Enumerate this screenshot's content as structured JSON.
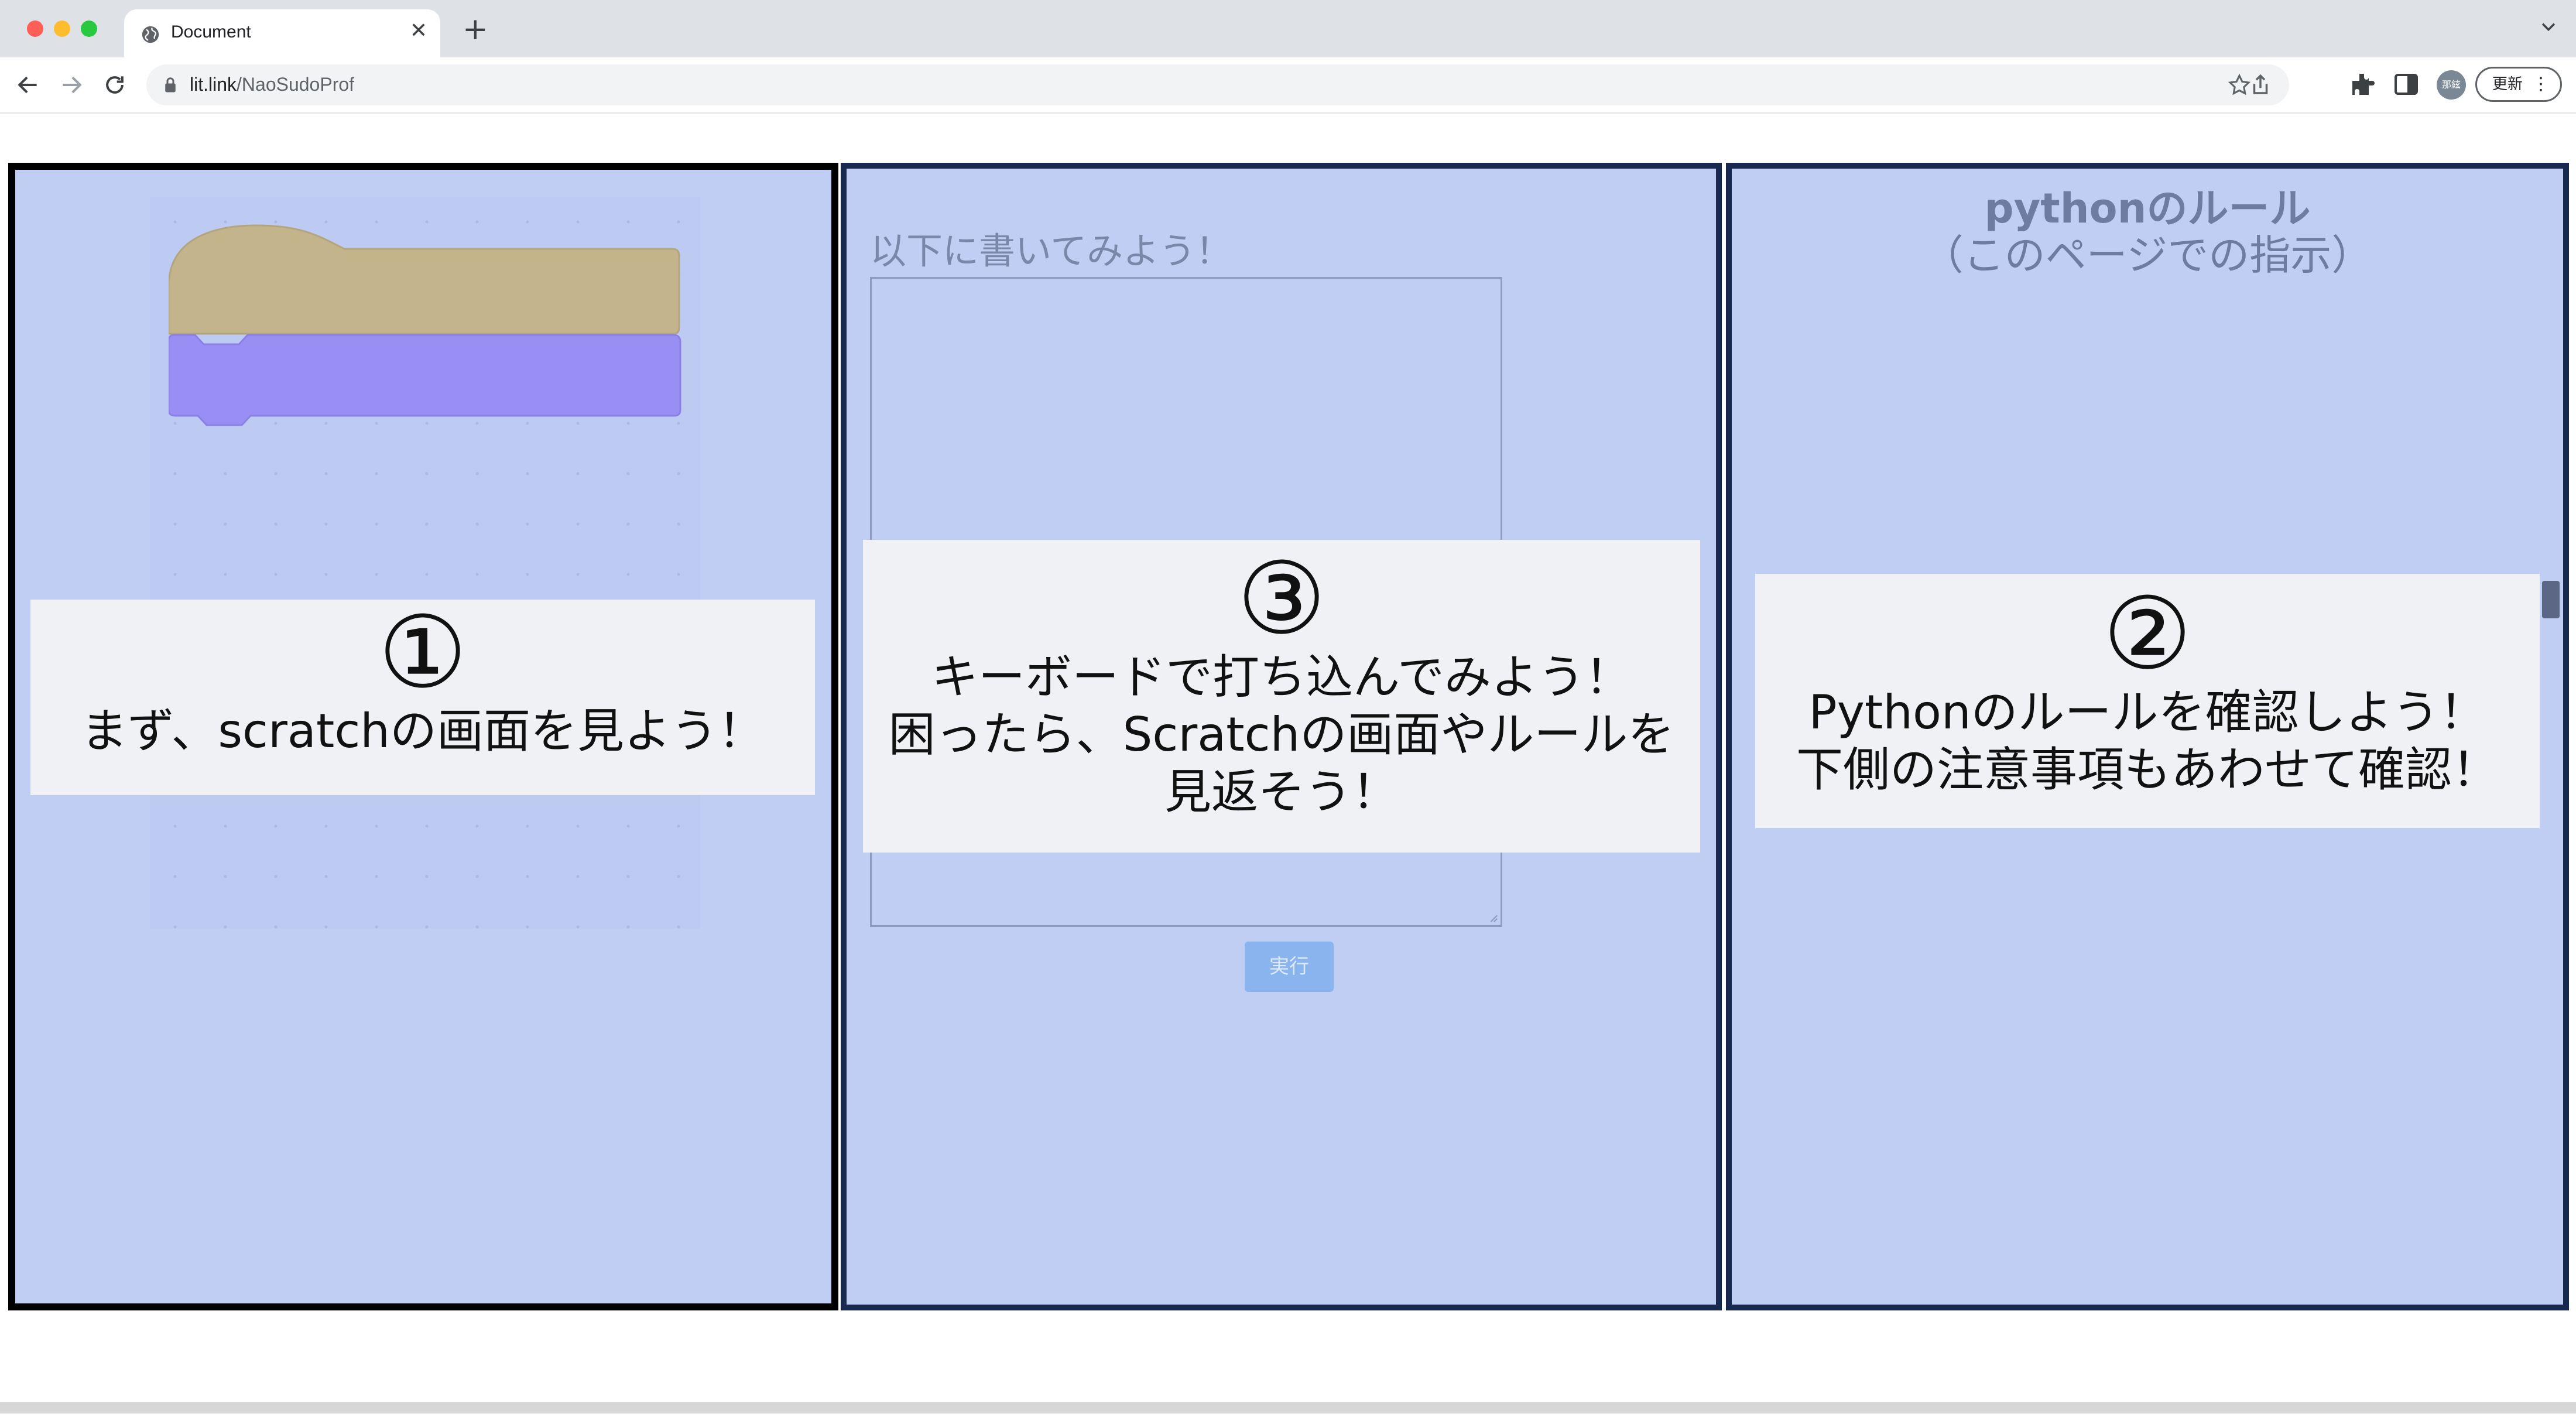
{
  "browser": {
    "tab_title": "Document",
    "url_host": "lit.link",
    "url_path": "/NaoSudoProf",
    "avatar_label": "那絃",
    "update_label": "更新",
    "colors": {
      "close": "#ff5f57",
      "minimize": "#febc2e",
      "maximize": "#28c840"
    }
  },
  "panel_left": {
    "callout_number": "①",
    "callout_text": "まず、scratchの画面を見よう！",
    "block_colors": {
      "hat": "#c4b48b",
      "stack": "#998ef4"
    }
  },
  "panel_middle": {
    "heading": "以下に書いてみよう！",
    "code_value": "",
    "run_label": "実行",
    "callout_number": "③",
    "callout_text": "キーボードで打ち込んでみよう！\n困ったら、Scratchの画面やルールを\n見返そう！"
  },
  "panel_right": {
    "title_line1": "pythonのルール",
    "title_line2": "（このページでの指示）",
    "callout_number": "②",
    "callout_text": "Pythonのルールを確認しよう！\n下側の注意事項もあわせて確認！"
  }
}
